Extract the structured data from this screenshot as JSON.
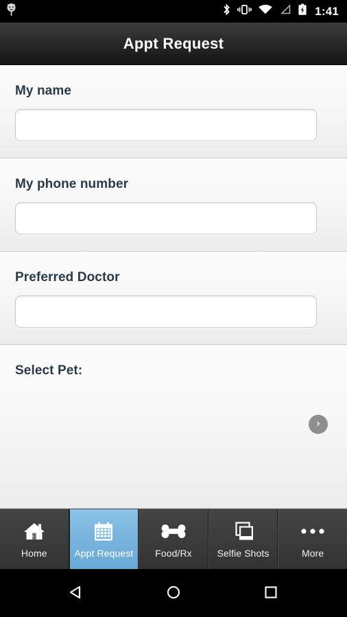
{
  "status_bar": {
    "notification_icon": "pet-face-icon",
    "icons": [
      "bluetooth-icon",
      "vibrate-icon",
      "wifi-icon",
      "cellular-signal-icon",
      "battery-charging-icon"
    ],
    "time": "1:41"
  },
  "app_bar": {
    "title": "Appt Request"
  },
  "form": {
    "fields": [
      {
        "label": "My name",
        "value": "",
        "placeholder": "",
        "name": "my-name"
      },
      {
        "label": "My phone number",
        "value": "",
        "placeholder": "",
        "name": "my-phone-number"
      },
      {
        "label": "Preferred Doctor",
        "value": "",
        "placeholder": "",
        "name": "preferred-doctor"
      }
    ],
    "pet_section": {
      "label": "Select Pet:",
      "next_button_icon": "chevron-right-icon"
    }
  },
  "tab_bar": {
    "active_index": 1,
    "active_color": "#7ab5de",
    "tabs": [
      {
        "label": "Home",
        "icon": "home-icon"
      },
      {
        "label": "Appt Request",
        "icon": "calendar-icon"
      },
      {
        "label": "Food/Rx",
        "icon": "bone-icon"
      },
      {
        "label": "Selfie Shots",
        "icon": "photos-icon"
      },
      {
        "label": "More",
        "icon": "ellipsis-icon"
      }
    ]
  },
  "nav_bar": {
    "buttons": [
      {
        "name": "back",
        "icon": "triangle-back-icon"
      },
      {
        "name": "home",
        "icon": "circle-home-icon"
      },
      {
        "name": "recents",
        "icon": "square-recents-icon"
      }
    ]
  }
}
